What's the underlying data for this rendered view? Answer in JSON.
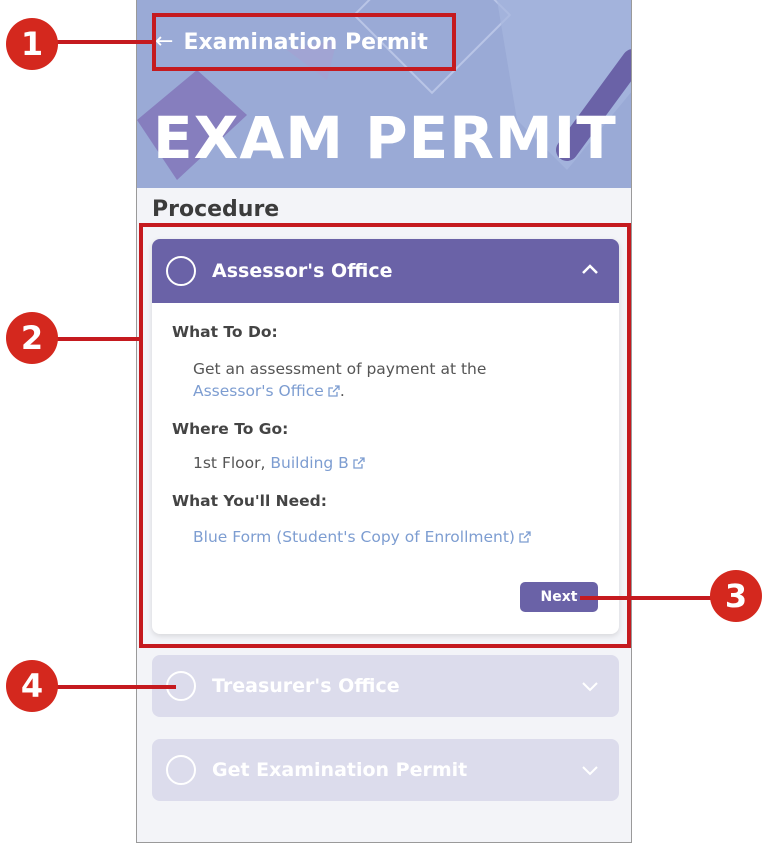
{
  "header": {
    "title": "Examination Permit",
    "back_icon": "arrow-left-icon",
    "banner_text": "EXAM PERMIT"
  },
  "section_title": "Procedure",
  "steps": [
    {
      "title": "Assessor's Office",
      "expanded": true,
      "what_to_do_label": "What To Do:",
      "what_to_do_text": "Get an assessment of payment at the",
      "what_to_do_link": "Assessor's Office",
      "what_to_do_suffix": ".",
      "where_to_go_label": "Where To Go:",
      "where_to_go_text": "1st Floor,",
      "where_to_go_link": "Building B",
      "what_you_need_label": "What You'll Need:",
      "what_you_need_link": "Blue Form (Student's Copy of Enrollment)",
      "next_label": "Next"
    },
    {
      "title": "Treasurer's Office",
      "expanded": false
    },
    {
      "title": "Get Examination Permit",
      "expanded": false
    }
  ],
  "annotations": [
    "1",
    "2",
    "3",
    "4"
  ],
  "colors": {
    "accent": "#6a62a7",
    "link": "#7d9dd1",
    "annotation": "#d4281e",
    "banner": "#9aaad6"
  }
}
